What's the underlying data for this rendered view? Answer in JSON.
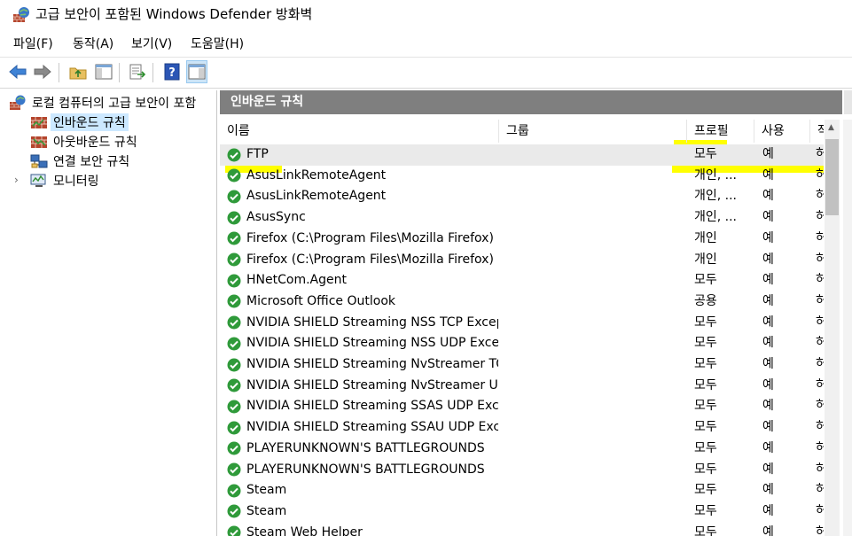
{
  "window": {
    "title": "고급 보안이 포함된 Windows Defender 방화벽",
    "icon": "firewall-globe-icon"
  },
  "menubar": {
    "items": [
      "파일(F)",
      "동작(A)",
      "보기(V)",
      "도움말(H)"
    ]
  },
  "toolbar": {
    "buttons": [
      "back-arrow-icon",
      "forward-arrow-icon",
      "folder-up-icon",
      "show-hide-tree-icon",
      "export-list-icon",
      "help-icon",
      "action-pane-icon"
    ]
  },
  "tree": {
    "items": [
      {
        "label": "로컬 컴퓨터의 고급 보안이 포함",
        "icon": "firewall-globe-icon",
        "selected": false
      },
      {
        "label": "인바운드 규칙",
        "icon": "firewall-wall-icon",
        "selected": true
      },
      {
        "label": "아웃바운드 규칙",
        "icon": "firewall-wall-icon",
        "selected": false
      },
      {
        "label": "연결 보안 규칙",
        "icon": "connection-security-icon",
        "selected": false
      },
      {
        "label": "모니터링",
        "icon": "monitor-icon",
        "selected": false,
        "expander": "›"
      }
    ]
  },
  "panel": {
    "header": "인바운드 규칙"
  },
  "table": {
    "columns": {
      "name": "이름",
      "group": "그룹",
      "profile": "프로필",
      "enabled": "사용",
      "action": "작"
    },
    "rows": [
      {
        "name": "FTP",
        "profile": "모두",
        "enabled": "예",
        "action": "허"
      },
      {
        "name": "AsusLinkRemoteAgent",
        "profile": "개인, ...",
        "enabled": "예",
        "action": "허"
      },
      {
        "name": "AsusLinkRemoteAgent",
        "profile": "개인, ...",
        "enabled": "예",
        "action": "허"
      },
      {
        "name": "AsusSync",
        "profile": "개인, ...",
        "enabled": "예",
        "action": "허"
      },
      {
        "name": "Firefox (C:\\Program Files\\Mozilla Firefox)",
        "profile": "개인",
        "enabled": "예",
        "action": "허"
      },
      {
        "name": "Firefox (C:\\Program Files\\Mozilla Firefox)",
        "profile": "개인",
        "enabled": "예",
        "action": "허"
      },
      {
        "name": "HNetCom.Agent",
        "profile": "모두",
        "enabled": "예",
        "action": "허"
      },
      {
        "name": "Microsoft Office Outlook",
        "profile": "공용",
        "enabled": "예",
        "action": "허"
      },
      {
        "name": "NVIDIA SHIELD Streaming NSS TCP Excep...",
        "profile": "모두",
        "enabled": "예",
        "action": "허"
      },
      {
        "name": "NVIDIA SHIELD Streaming NSS UDP Exce...",
        "profile": "모두",
        "enabled": "예",
        "action": "허"
      },
      {
        "name": "NVIDIA SHIELD Streaming NvStreamer TC...",
        "profile": "모두",
        "enabled": "예",
        "action": "허"
      },
      {
        "name": "NVIDIA SHIELD Streaming NvStreamer U...",
        "profile": "모두",
        "enabled": "예",
        "action": "허"
      },
      {
        "name": "NVIDIA SHIELD Streaming SSAS UDP Exc...",
        "profile": "모두",
        "enabled": "예",
        "action": "허"
      },
      {
        "name": "NVIDIA SHIELD Streaming SSAU UDP Exc...",
        "profile": "모두",
        "enabled": "예",
        "action": "허"
      },
      {
        "name": "PLAYERUNKNOWN'S BATTLEGROUNDS",
        "profile": "모두",
        "enabled": "예",
        "action": "허"
      },
      {
        "name": "PLAYERUNKNOWN'S BATTLEGROUNDS",
        "profile": "모두",
        "enabled": "예",
        "action": "허"
      },
      {
        "name": "Steam",
        "profile": "모두",
        "enabled": "예",
        "action": "허"
      },
      {
        "name": "Steam",
        "profile": "모두",
        "enabled": "예",
        "action": "허"
      },
      {
        "name": "Steam Web Helper",
        "profile": "모두",
        "enabled": "예",
        "action": "허"
      }
    ]
  },
  "colors": {
    "header_bg": "#7f7f7f",
    "highlighter": "#ffff00",
    "selection": "#cce8ff",
    "enabled_check": "#2f9a3a"
  }
}
